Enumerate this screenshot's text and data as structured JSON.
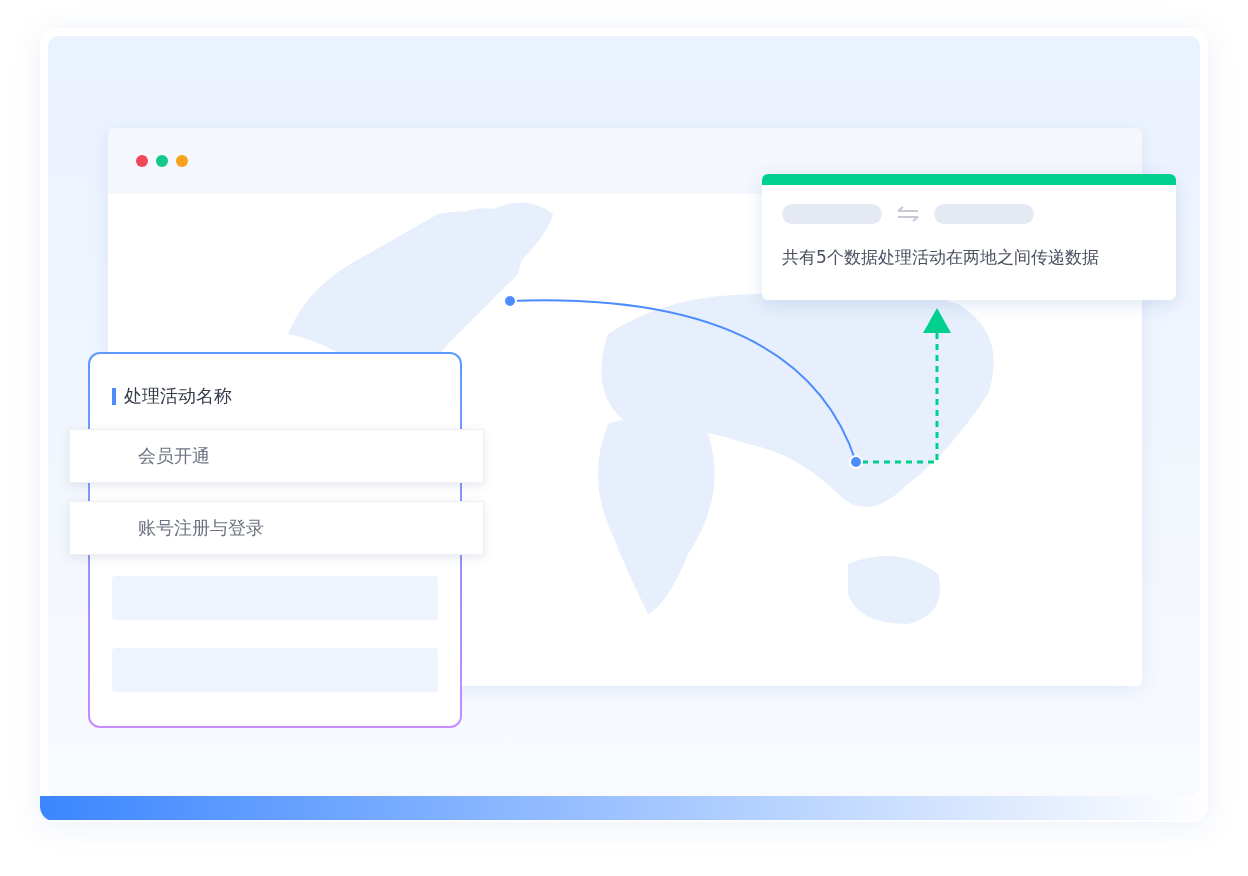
{
  "window": {
    "dots": [
      {
        "color": "#f0475a"
      },
      {
        "color": "#10c98a"
      },
      {
        "color": "#f8a21c"
      }
    ]
  },
  "transfer_card": {
    "text": "共有5个数据处理活动在两地之间传递数据"
  },
  "activity_panel": {
    "title": "处理活动名称",
    "items": [
      {
        "label": "会员开通"
      },
      {
        "label": "账号注册与登录"
      }
    ]
  }
}
